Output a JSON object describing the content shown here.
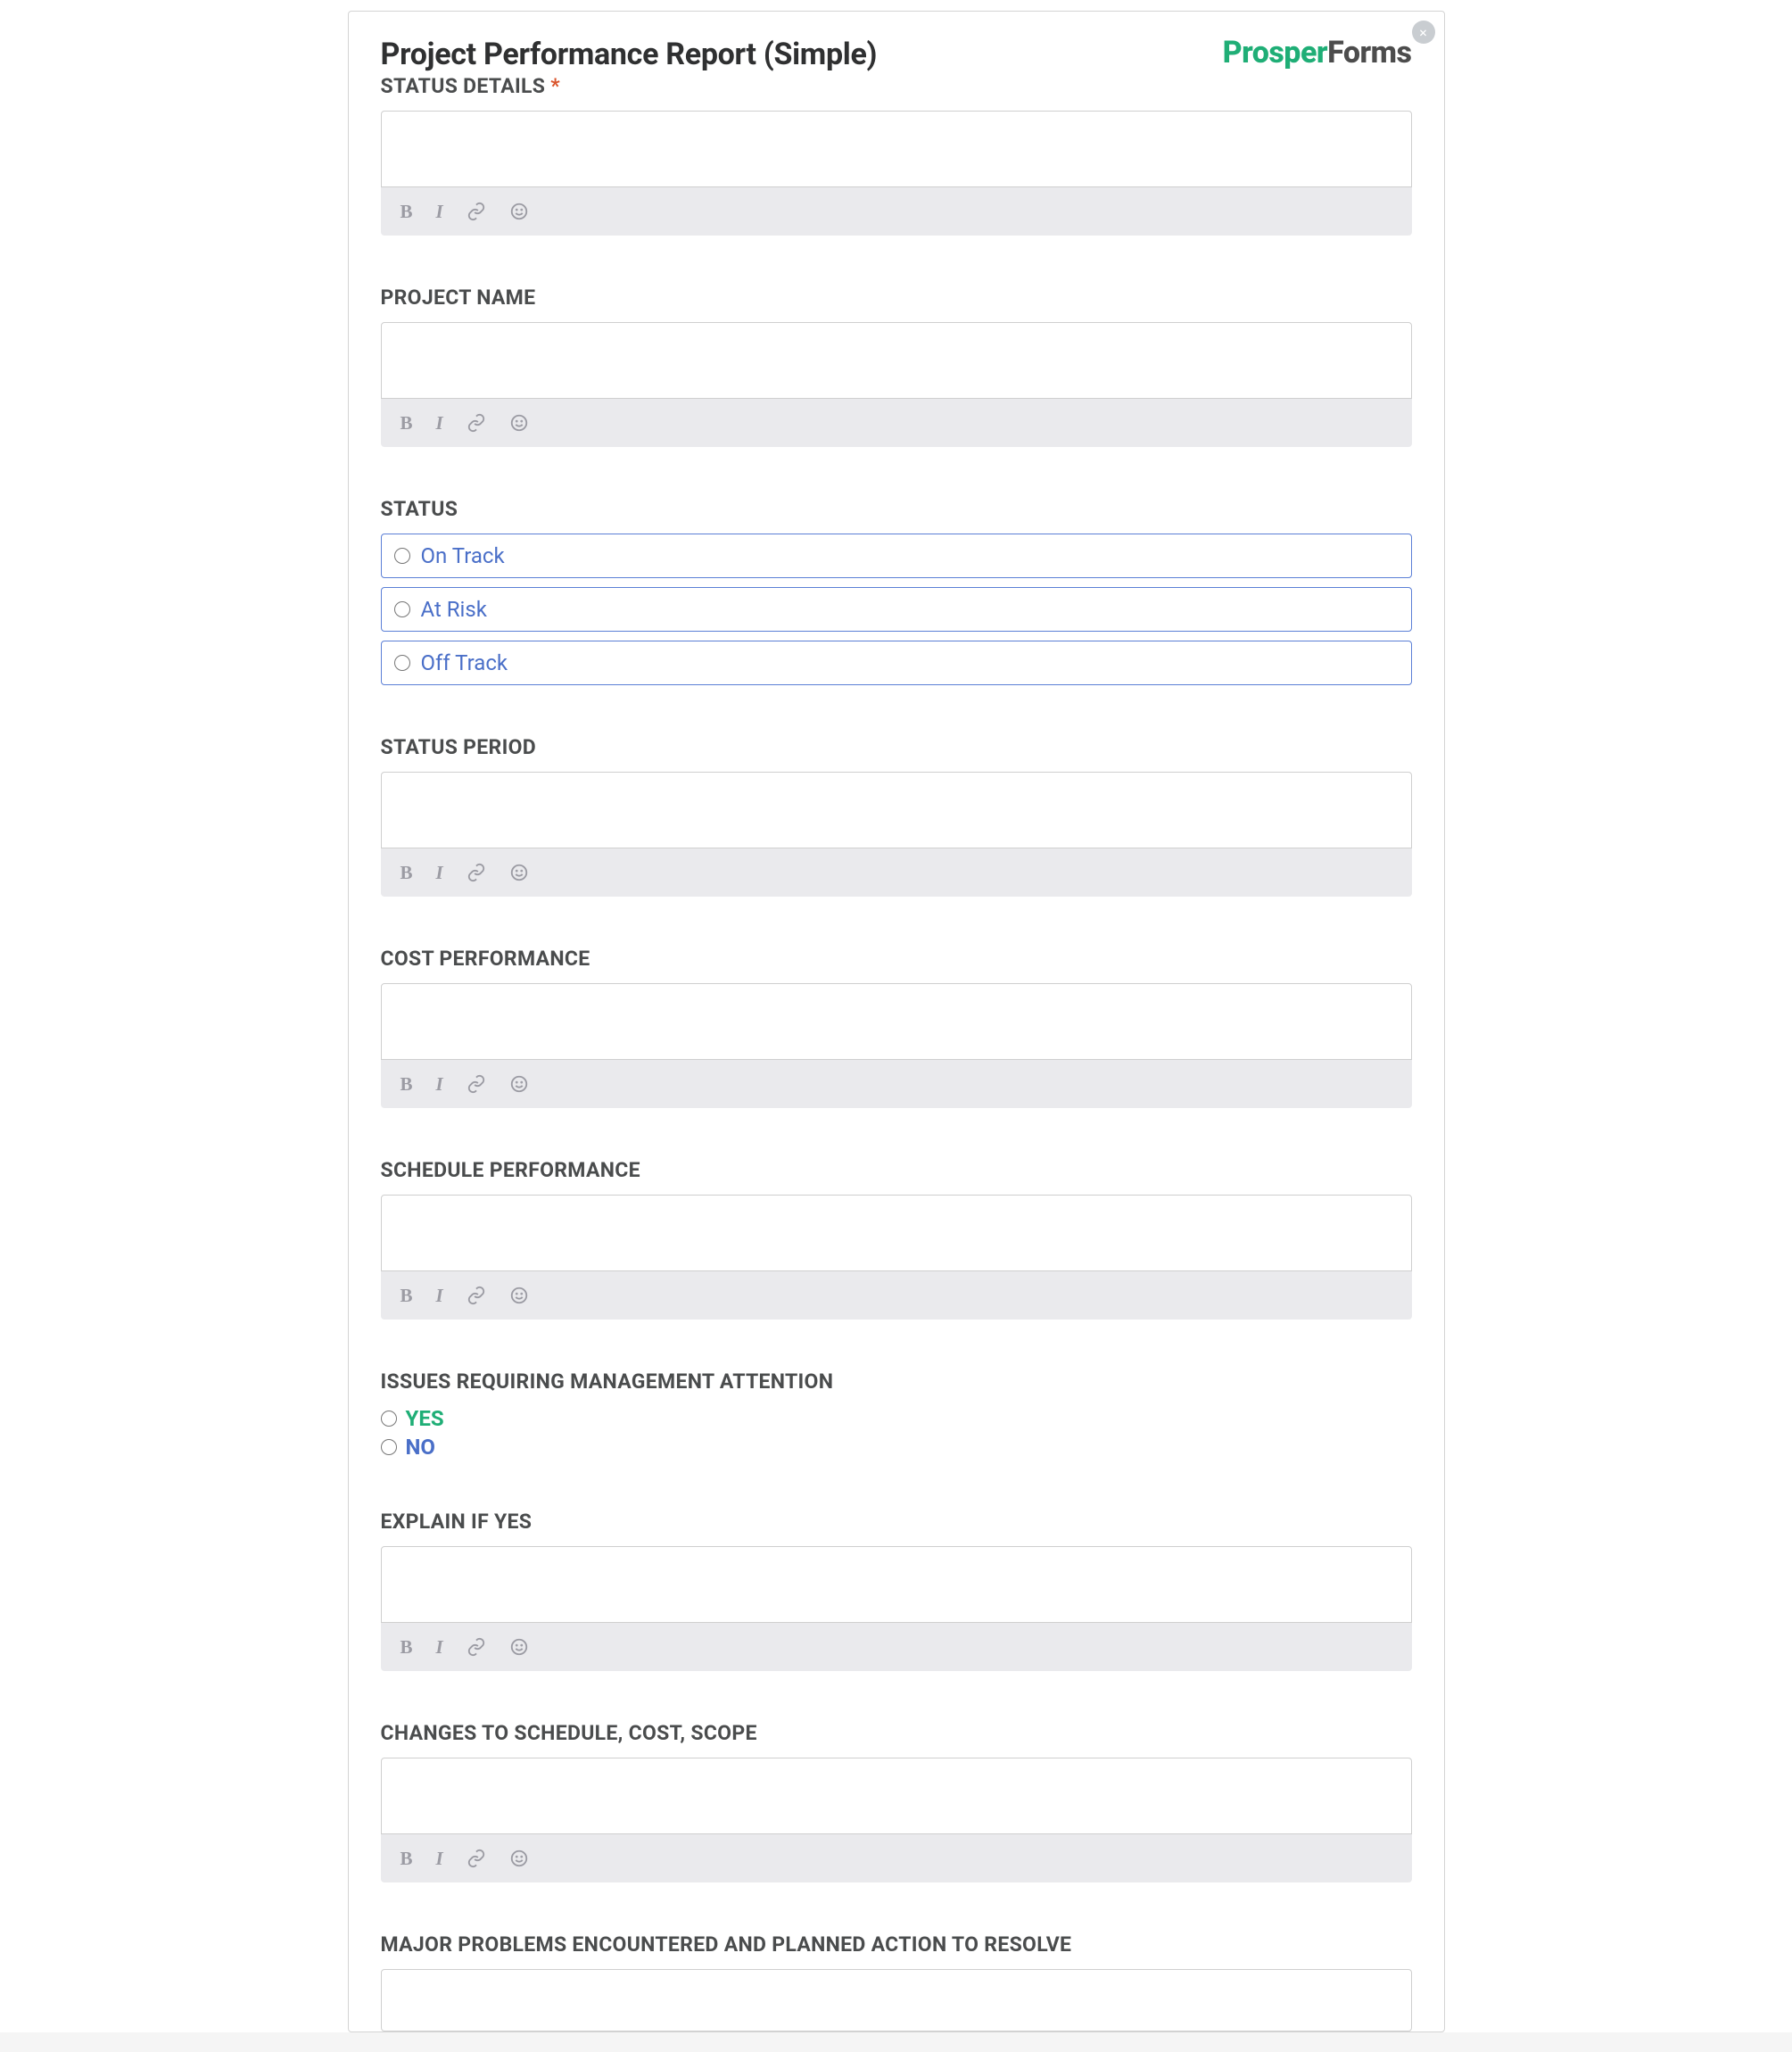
{
  "header": {
    "title": "Project Performance Report (Simple)",
    "logo_part1": "Prosper",
    "logo_part2": "Forms",
    "close_text": "×"
  },
  "fields": {
    "status_details": {
      "label": "STATUS DETAILS",
      "required_marker": "*"
    },
    "project_name": {
      "label": "PROJECT NAME"
    },
    "status": {
      "label": "STATUS",
      "options": [
        {
          "label": "On Track"
        },
        {
          "label": "At Risk"
        },
        {
          "label": "Off Track"
        }
      ]
    },
    "status_period": {
      "label": "STATUS PERIOD"
    },
    "cost_performance": {
      "label": "COST PERFORMANCE"
    },
    "schedule_performance": {
      "label": "SCHEDULE PERFORMANCE"
    },
    "issues_attention": {
      "label": "ISSUES REQUIRING MANAGEMENT ATTENTION",
      "options": [
        {
          "label": "YES"
        },
        {
          "label": "NO"
        }
      ]
    },
    "explain_if_yes": {
      "label": "EXPLAIN IF YES"
    },
    "changes": {
      "label": "CHANGES TO SCHEDULE, COST, SCOPE"
    },
    "major_problems": {
      "label": "MAJOR PROBLEMS ENCOUNTERED AND PLANNED ACTION TO RESOLVE"
    }
  },
  "toolbar": {
    "bold": "B",
    "italic": "I"
  }
}
